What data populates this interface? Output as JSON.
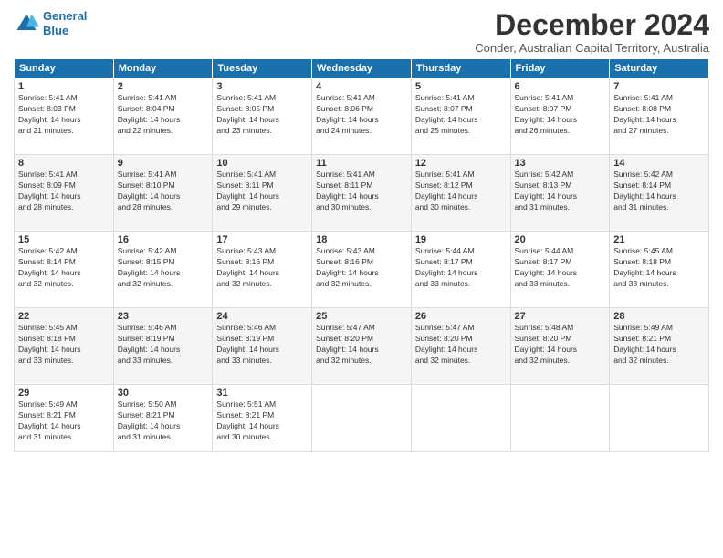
{
  "header": {
    "logo_line1": "General",
    "logo_line2": "Blue",
    "month_title": "December 2024",
    "subtitle": "Conder, Australian Capital Territory, Australia"
  },
  "days_of_week": [
    "Sunday",
    "Monday",
    "Tuesday",
    "Wednesday",
    "Thursday",
    "Friday",
    "Saturday"
  ],
  "weeks": [
    [
      {
        "day": "1",
        "sunrise": "5:41 AM",
        "sunset": "8:03 PM",
        "daylight": "14 hours and 21 minutes."
      },
      {
        "day": "2",
        "sunrise": "5:41 AM",
        "sunset": "8:04 PM",
        "daylight": "14 hours and 22 minutes."
      },
      {
        "day": "3",
        "sunrise": "5:41 AM",
        "sunset": "8:05 PM",
        "daylight": "14 hours and 23 minutes."
      },
      {
        "day": "4",
        "sunrise": "5:41 AM",
        "sunset": "8:06 PM",
        "daylight": "14 hours and 24 minutes."
      },
      {
        "day": "5",
        "sunrise": "5:41 AM",
        "sunset": "8:07 PM",
        "daylight": "14 hours and 25 minutes."
      },
      {
        "day": "6",
        "sunrise": "5:41 AM",
        "sunset": "8:07 PM",
        "daylight": "14 hours and 26 minutes."
      },
      {
        "day": "7",
        "sunrise": "5:41 AM",
        "sunset": "8:08 PM",
        "daylight": "14 hours and 27 minutes."
      }
    ],
    [
      {
        "day": "8",
        "sunrise": "5:41 AM",
        "sunset": "8:09 PM",
        "daylight": "14 hours and 28 minutes."
      },
      {
        "day": "9",
        "sunrise": "5:41 AM",
        "sunset": "8:10 PM",
        "daylight": "14 hours and 28 minutes."
      },
      {
        "day": "10",
        "sunrise": "5:41 AM",
        "sunset": "8:11 PM",
        "daylight": "14 hours and 29 minutes."
      },
      {
        "day": "11",
        "sunrise": "5:41 AM",
        "sunset": "8:11 PM",
        "daylight": "14 hours and 30 minutes."
      },
      {
        "day": "12",
        "sunrise": "5:41 AM",
        "sunset": "8:12 PM",
        "daylight": "14 hours and 30 minutes."
      },
      {
        "day": "13",
        "sunrise": "5:42 AM",
        "sunset": "8:13 PM",
        "daylight": "14 hours and 31 minutes."
      },
      {
        "day": "14",
        "sunrise": "5:42 AM",
        "sunset": "8:14 PM",
        "daylight": "14 hours and 31 minutes."
      }
    ],
    [
      {
        "day": "15",
        "sunrise": "5:42 AM",
        "sunset": "8:14 PM",
        "daylight": "14 hours and 32 minutes."
      },
      {
        "day": "16",
        "sunrise": "5:42 AM",
        "sunset": "8:15 PM",
        "daylight": "14 hours and 32 minutes."
      },
      {
        "day": "17",
        "sunrise": "5:43 AM",
        "sunset": "8:16 PM",
        "daylight": "14 hours and 32 minutes."
      },
      {
        "day": "18",
        "sunrise": "5:43 AM",
        "sunset": "8:16 PM",
        "daylight": "14 hours and 32 minutes."
      },
      {
        "day": "19",
        "sunrise": "5:44 AM",
        "sunset": "8:17 PM",
        "daylight": "14 hours and 33 minutes."
      },
      {
        "day": "20",
        "sunrise": "5:44 AM",
        "sunset": "8:17 PM",
        "daylight": "14 hours and 33 minutes."
      },
      {
        "day": "21",
        "sunrise": "5:45 AM",
        "sunset": "8:18 PM",
        "daylight": "14 hours and 33 minutes."
      }
    ],
    [
      {
        "day": "22",
        "sunrise": "5:45 AM",
        "sunset": "8:18 PM",
        "daylight": "14 hours and 33 minutes."
      },
      {
        "day": "23",
        "sunrise": "5:46 AM",
        "sunset": "8:19 PM",
        "daylight": "14 hours and 33 minutes."
      },
      {
        "day": "24",
        "sunrise": "5:46 AM",
        "sunset": "8:19 PM",
        "daylight": "14 hours and 33 minutes."
      },
      {
        "day": "25",
        "sunrise": "5:47 AM",
        "sunset": "8:20 PM",
        "daylight": "14 hours and 32 minutes."
      },
      {
        "day": "26",
        "sunrise": "5:47 AM",
        "sunset": "8:20 PM",
        "daylight": "14 hours and 32 minutes."
      },
      {
        "day": "27",
        "sunrise": "5:48 AM",
        "sunset": "8:20 PM",
        "daylight": "14 hours and 32 minutes."
      },
      {
        "day": "28",
        "sunrise": "5:49 AM",
        "sunset": "8:21 PM",
        "daylight": "14 hours and 32 minutes."
      }
    ],
    [
      {
        "day": "29",
        "sunrise": "5:49 AM",
        "sunset": "8:21 PM",
        "daylight": "14 hours and 31 minutes."
      },
      {
        "day": "30",
        "sunrise": "5:50 AM",
        "sunset": "8:21 PM",
        "daylight": "14 hours and 31 minutes."
      },
      {
        "day": "31",
        "sunrise": "5:51 AM",
        "sunset": "8:21 PM",
        "daylight": "14 hours and 30 minutes."
      },
      null,
      null,
      null,
      null
    ]
  ]
}
